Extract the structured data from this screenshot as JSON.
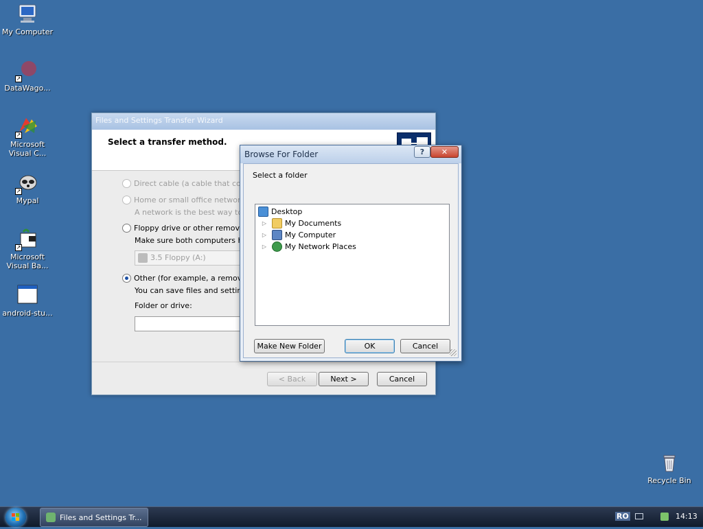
{
  "desktop": {
    "icons": [
      {
        "label": "My Computer",
        "icon": "my-computer-icon"
      },
      {
        "label": "DataWago...",
        "icon": "datawagon-icon"
      },
      {
        "label": "Microsoft Visual C...",
        "icon": "visual-c-icon"
      },
      {
        "label": "Mypal",
        "icon": "mypal-icon"
      },
      {
        "label": "Microsoft Visual Ba...",
        "icon": "visual-basic-icon"
      },
      {
        "label": "android-stu...",
        "icon": "android-studio-icon"
      },
      {
        "label": "Recycle Bin",
        "icon": "recycle-bin-icon"
      }
    ]
  },
  "wizard": {
    "title": "Files and Settings Transfer Wizard",
    "header_title": "Select a transfer method.",
    "options": {
      "direct_cable": "Direct cable (a cable that conne",
      "home_network": "Home or small office network",
      "home_network_desc": "A network is the best way to tra",
      "floppy": "Floppy drive or other removable r",
      "floppy_desc": "Make sure both computers have",
      "floppy_combo_value": "3.5 Floppy (A:)",
      "other": "Other (for example, a removable c",
      "other_desc": "You can save files and settings t",
      "folder_label": "Folder or drive:"
    },
    "buttons": {
      "back": "< Back",
      "next": "Next >",
      "cancel": "Cancel"
    }
  },
  "browse_dialog": {
    "title": "Browse For Folder",
    "help_glyph": "?",
    "close_glyph": "✕",
    "instruction": "Select a folder",
    "tree": {
      "root": "Desktop",
      "children": [
        "My Documents",
        "My Computer",
        "My Network Places"
      ]
    },
    "buttons": {
      "make_new_folder": "Make New Folder",
      "ok": "OK",
      "cancel": "Cancel"
    }
  },
  "taskbar": {
    "task_label": "Files and Settings Tr...",
    "language": "RO",
    "clock": "14:13"
  }
}
